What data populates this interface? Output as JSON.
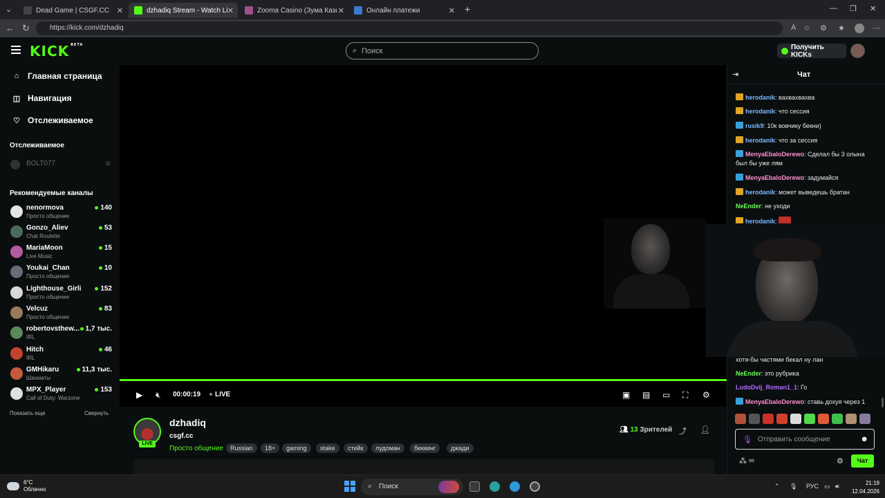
{
  "browser": {
    "tabs": [
      {
        "title": "Dead Game | CSGF.CC",
        "active": false
      },
      {
        "title": "dzhadiq Stream - Watch Live on Kick",
        "active": true
      },
      {
        "title": "Zooma Casino (Зума Казино)",
        "active": false
      },
      {
        "title": "Онлайн платежи",
        "active": false
      }
    ],
    "new_tab": "+",
    "url": "https://kick.com/dzhadiq"
  },
  "header": {
    "logo": "KICK",
    "logo_badge": "BETA",
    "search_placeholder": "Поиск",
    "get_kicks": "Получить KICKs"
  },
  "sidebar": {
    "nav": [
      {
        "label": "Главная страница",
        "icon": "home-icon"
      },
      {
        "label": "Навигация",
        "icon": "compass-icon"
      },
      {
        "label": "Отслеживаемое",
        "icon": "heart-icon"
      }
    ],
    "followed_heading": "Отслеживаемое",
    "followed": [
      {
        "name": "BOLT077"
      }
    ],
    "recommended_heading": "Рекомендуемые каналы",
    "channels": [
      {
        "name": "nenormova",
        "category": "Просто общение",
        "viewers": "140",
        "color": "#e6e6e6"
      },
      {
        "name": "Gonzo_Aliev",
        "category": "Chat Roulette",
        "viewers": "53",
        "color": "#4c6a5a"
      },
      {
        "name": "MariaMoon",
        "category": "Live Music",
        "viewers": "15",
        "color": "#b35aa0"
      },
      {
        "name": "Youkai_Chan",
        "category": "Просто общение",
        "viewers": "10",
        "color": "#6a6a7a"
      },
      {
        "name": "Lighthouse_Girlie",
        "category": "Просто общение",
        "viewers": "152",
        "color": "#d8d8d8"
      },
      {
        "name": "Velcuz",
        "category": "Просто общение",
        "viewers": "83",
        "color": "#9a7a5a"
      },
      {
        "name": "robertovsthew...",
        "category": "IRL",
        "viewers": "1,7 тыс.",
        "color": "#5a8a5a"
      },
      {
        "name": "Hitch",
        "category": "IRL",
        "viewers": "46",
        "color": "#c0442c"
      },
      {
        "name": "GMHikaru",
        "category": "Шахматы",
        "viewers": "11,3 тыс.",
        "color": "#c45a3a"
      },
      {
        "name": "MPX_Player",
        "category": "Call of Duty: Warzone",
        "viewers": "153",
        "color": "#e0e0e0"
      }
    ],
    "show_more": "Показать еще",
    "collapse": "Свернуть"
  },
  "player": {
    "time": "00:00:19",
    "live": "LIVE"
  },
  "stream": {
    "name": "dzhadiq",
    "live_badge": "LIVE",
    "title": "csgf.cc",
    "category": "Просто общение",
    "tags": [
      "Russian",
      "18+",
      "gaming",
      "stake",
      "стейк",
      "лудоман",
      "беккинг",
      "джади"
    ],
    "viewers_count": "13",
    "viewers_label": "Зрителей"
  },
  "chat": {
    "title": "Чат",
    "messages_top": [
      {
        "user": "herodanik",
        "text": ": вахвахвахва",
        "badge": "crown",
        "color": "#7ab8ff"
      },
      {
        "user": "herodanik",
        "text": ": что сессия",
        "badge": "crown",
        "color": "#7ab8ff"
      },
      {
        "user": "rusik9",
        "text": ": 10к вовчику бекни)",
        "badge": "blue",
        "color": "#7ab8ff"
      },
      {
        "user": "herodanik",
        "text": ": что за сессия",
        "badge": "crown",
        "color": "#7ab8ff"
      },
      {
        "user": "MenyaEbaloDerewo",
        "text": ": Сделал бы 3 олына был бы уже лям",
        "badge": "blue",
        "color": "#ff8fd0"
      },
      {
        "user": "MenyaEbaloDerewo",
        "text": ": задумайся",
        "badge": "blue",
        "color": "#ff8fd0"
      },
      {
        "user": "herodanik",
        "text": ": может выведешь братан",
        "badge": "crown",
        "color": "#7ab8ff"
      },
      {
        "user": "NeEnder",
        "text": ": не уходи",
        "badge": "",
        "color": "#6dff5a"
      },
      {
        "user": "herodanik",
        "text": ":",
        "badge": "crown",
        "color": "#7ab8ff"
      }
    ],
    "messages_bottom": [
      {
        "user": "",
        "text": "хотя-бы частями бекал ну лан",
        "badge": "",
        "color": "#e8e8e8"
      },
      {
        "user": "NeEnder",
        "text": ": это рубрика",
        "badge": "",
        "color": "#6dff5a"
      },
      {
        "user": "LudoDvij_Roman1_1",
        "text": ": Го",
        "badge": "",
        "color": "#b06bff"
      },
      {
        "user": "MenyaEbaloDerewo",
        "text": ": ставь дохуя через 1",
        "badge": "blue",
        "color": "#ff8fd0"
      }
    ],
    "input_placeholder": "Отправить сообщение",
    "send_label": "Чат"
  },
  "taskbar": {
    "weather_temp": "6°C",
    "weather_desc": "Облачно",
    "search_label": "Поиск",
    "lang": "РУС",
    "time": "21:19",
    "date": "12.04.2026"
  }
}
